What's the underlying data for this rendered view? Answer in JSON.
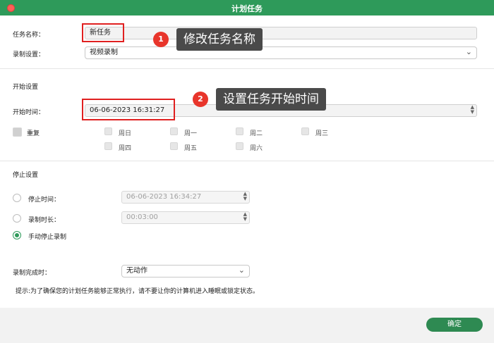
{
  "window": {
    "title": "计划任务"
  },
  "task": {
    "name_label": "任务名称：",
    "name_value": "新任务",
    "rec_label": "录制设置：",
    "rec_value": "视频录制"
  },
  "start": {
    "section": "开始设置",
    "time_label": "开始时间：",
    "time_value": "06-06-2023 16:31:27",
    "repeat_label": "重复",
    "days": [
      "周日",
      "周一",
      "周二",
      "周三",
      "周四",
      "周五",
      "周六"
    ]
  },
  "stop": {
    "section": "停止设置",
    "stop_time_label": "停止时间：",
    "stop_time_value": "06-06-2023 16:34:27",
    "duration_label": "录制时长：",
    "duration_value": "00:03:00",
    "manual_label": "手动停止录制"
  },
  "finish": {
    "label": "录制完成时：",
    "value": "无动作"
  },
  "note": "提示:为了确保您的计划任务能够正常执行，请不要让你的计算机进入睡眠或锁定状态。",
  "buttons": {
    "ok": "确定"
  },
  "annotations": {
    "badge1": "1",
    "callout1": "修改任务名称",
    "badge2": "2",
    "callout2": "设置任务开始时间"
  },
  "colors": {
    "accent": "#2e9a5a",
    "annotation_red": "#e02020",
    "callout_bg": "#4a4a4a"
  }
}
